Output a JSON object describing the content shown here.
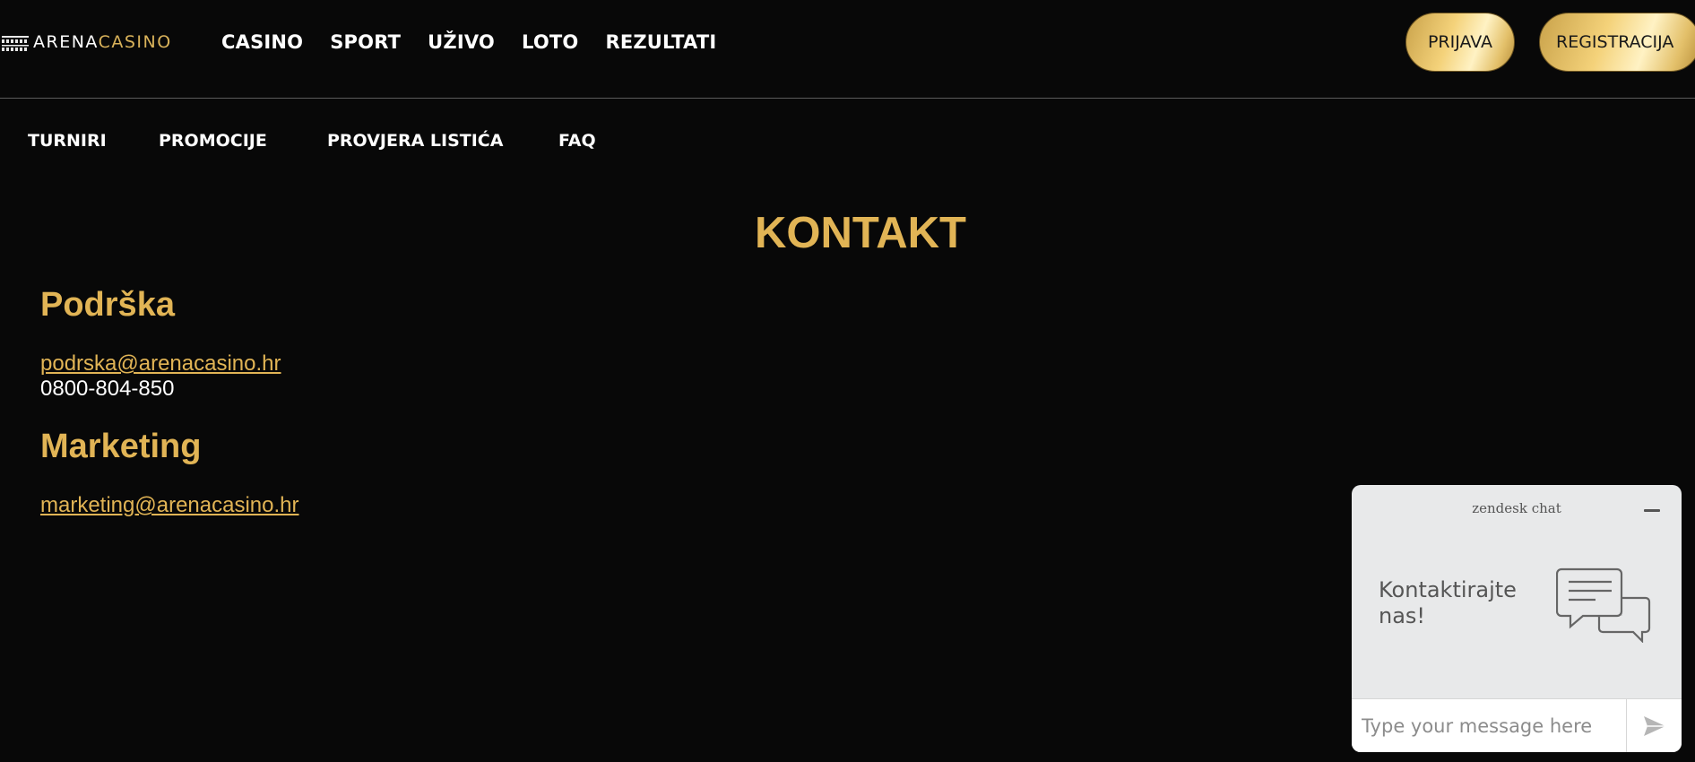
{
  "header": {
    "logo": {
      "part1": "ARENA",
      "part2": "CASINO"
    },
    "nav": [
      {
        "label": "CASINO"
      },
      {
        "label": "SPORT"
      },
      {
        "label": "UŽIVO"
      },
      {
        "label": "LOTO"
      },
      {
        "label": "REZULTATI"
      }
    ],
    "login_label": "PRIJAVA",
    "register_label": "REGISTRACIJA"
  },
  "sub_nav": [
    {
      "label": "TURNIRI"
    },
    {
      "label": "PROMOCIJE"
    },
    {
      "label": "PROVJERA LISTIĆA"
    },
    {
      "label": "FAQ"
    }
  ],
  "content": {
    "title": "KONTAKT",
    "support": {
      "heading": "Podrška",
      "email": "podrska@arenacasino.hr",
      "phone": "0800-804-850"
    },
    "marketing": {
      "heading": "Marketing",
      "email": "marketing@arenacasino.hr"
    }
  },
  "chat": {
    "header": "zendesk chat",
    "prompt": "Kontaktirajte nas!",
    "input_placeholder": "Type your message here",
    "icons": {
      "minimize": "minimize-icon",
      "send": "send-icon",
      "illustration": "chat-bubbles-icon"
    }
  },
  "colors": {
    "background": "#080808",
    "accent_gold": "#e1b455",
    "chat_bg": "#e8e9ea"
  }
}
